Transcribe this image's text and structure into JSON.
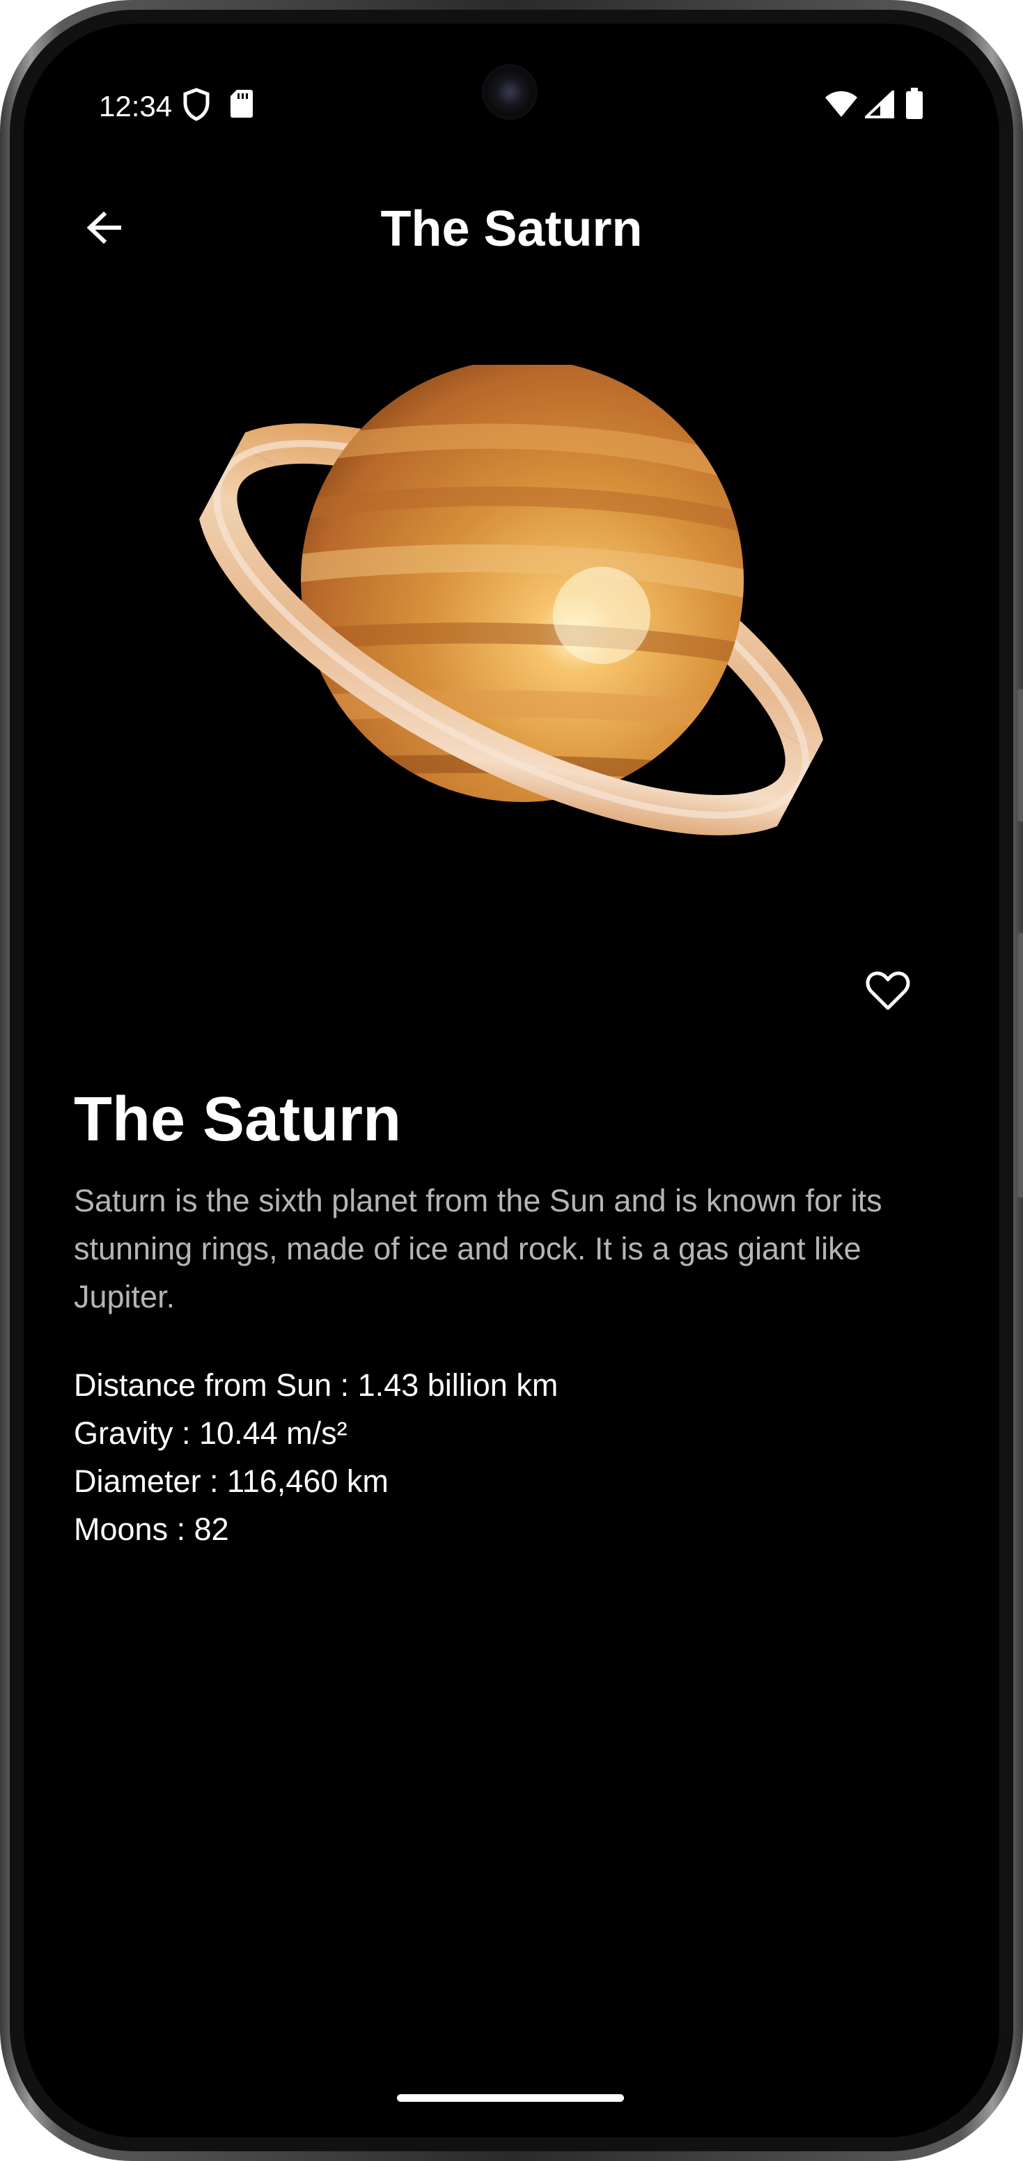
{
  "status_bar": {
    "time": "12:34",
    "icons": [
      "shield-icon",
      "sd-card-icon",
      "wifi-icon",
      "signal-icon",
      "battery-icon"
    ]
  },
  "app_bar": {
    "title": "The Saturn",
    "back_icon": "arrow-back-icon"
  },
  "planet": {
    "image_icon": "saturn-planet-image",
    "favorite_icon": "heart-outline-icon",
    "name": "The Saturn",
    "description": "Saturn is the sixth planet from the Sun and is known for its stunning rings, made of ice and rock. It is a gas giant like Jupiter.",
    "facts": [
      "Distance from Sun : 1.43 billion km",
      "Gravity : 10.44 m/s²",
      "Diameter : 116,460 km",
      "Moons : 82"
    ]
  },
  "colors": {
    "background": "#000000",
    "text_primary": "#ffffff",
    "text_secondary": "#b5b5b5"
  }
}
